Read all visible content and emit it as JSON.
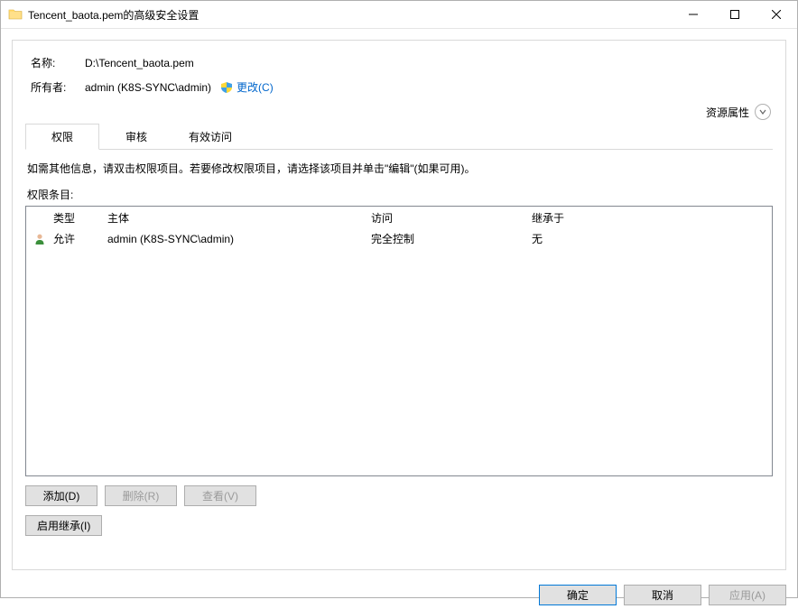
{
  "window": {
    "title": "Tencent_baota.pem的高级安全设置"
  },
  "name_label": "名称:",
  "name_value": "D:\\Tencent_baota.pem",
  "owner_label": "所有者:",
  "owner_value": "admin (K8S-SYNC\\admin)",
  "change_link": "更改(C)",
  "resource_label": "资源属性",
  "tabs": {
    "perm": "权限",
    "audit": "审核",
    "effective": "有效访问"
  },
  "instruction": "如需其他信息，请双击权限项目。若要修改权限项目，请选择该项目并单击\"编辑\"(如果可用)。",
  "entries_label": "权限条目:",
  "headers": {
    "type": "类型",
    "principal": "主体",
    "access": "访问",
    "inherit": "继承于"
  },
  "row": {
    "type": "允许",
    "principal": "admin (K8S-SYNC\\admin)",
    "access": "完全控制",
    "inherit": "无"
  },
  "buttons": {
    "add": "添加(D)",
    "remove": "删除(R)",
    "view": "查看(V)",
    "enable_inherit": "启用继承(I)",
    "ok": "确定",
    "cancel": "取消",
    "apply": "应用(A)"
  }
}
